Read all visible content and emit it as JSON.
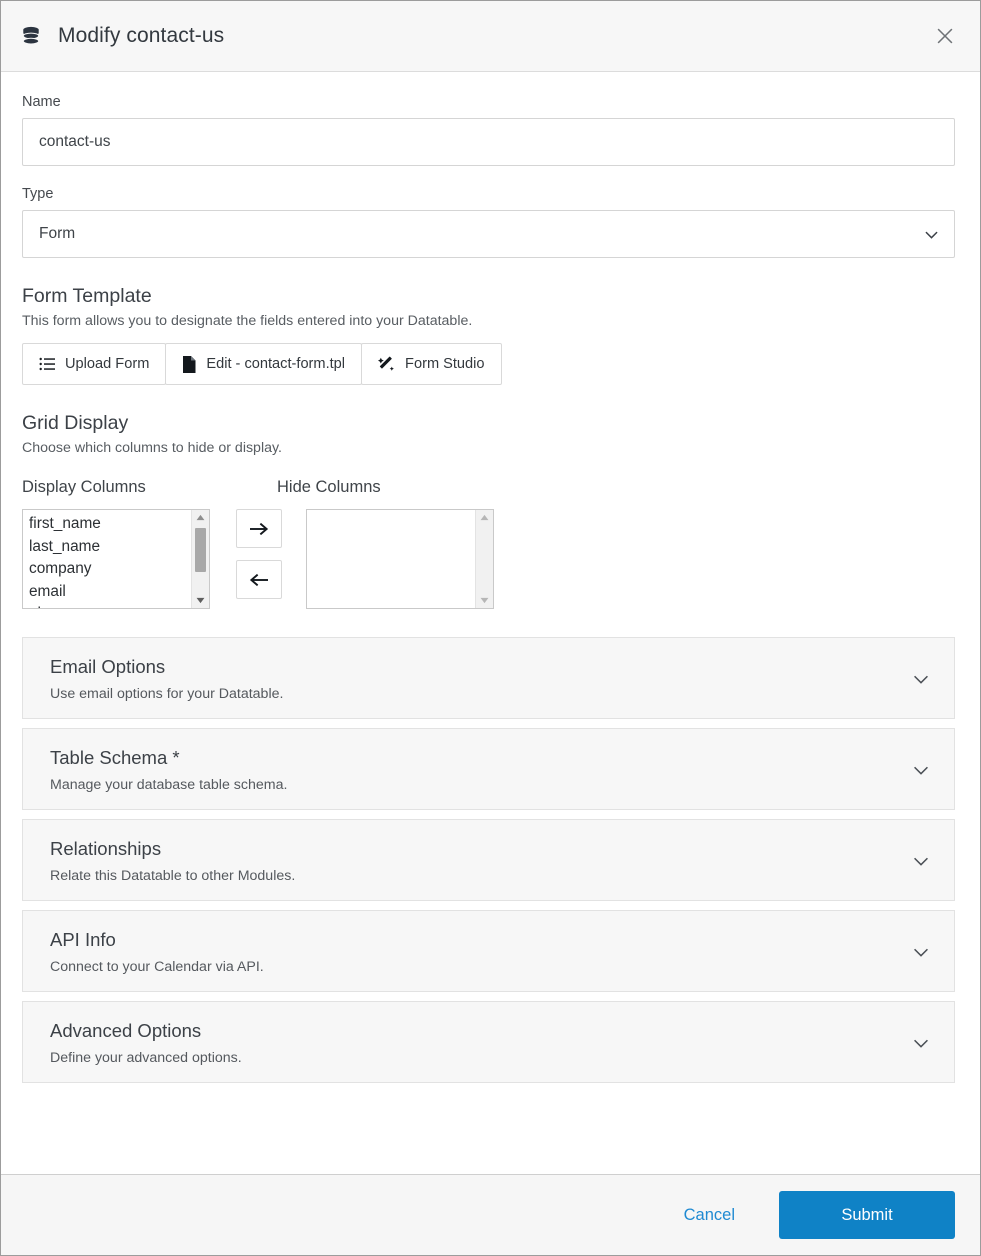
{
  "header": {
    "icon": "database-icon",
    "title": "Modify contact-us",
    "close_label": "×"
  },
  "form": {
    "name_label": "Name",
    "name_value": "contact-us",
    "name_placeholder": "",
    "type_label": "Type",
    "type_value": "Form",
    "type_options": [
      "Form"
    ]
  },
  "form_template": {
    "title": "Form Template",
    "description": "This form allows you to designate the fields entered into your Datatable.",
    "buttons": [
      {
        "label": "Upload Form",
        "icon": "list-icon"
      },
      {
        "label": "Edit - contact-form.tpl",
        "icon": "file-icon"
      },
      {
        "label": "Form Studio",
        "icon": "magic-wand-icon"
      }
    ]
  },
  "grid_display": {
    "title": "Grid Display",
    "description": "Choose which columns to hide or display.",
    "display_columns_label": "Display Columns",
    "hide_columns_label": "Hide Columns",
    "display_columns": [
      "first_name",
      "last_name",
      "company",
      "email",
      "phone"
    ],
    "hide_columns": [],
    "move_right_label": "→",
    "move_left_label": "←"
  },
  "panels": [
    {
      "title": "Email Options",
      "description": "Use email options for your Datatable."
    },
    {
      "title": "Table Schema *",
      "description": "Manage your database table schema."
    },
    {
      "title": "Relationships",
      "description": "Relate this Datatable to other Modules."
    },
    {
      "title": "API Info",
      "description": "Connect to your Calendar via API."
    },
    {
      "title": "Advanced Options",
      "description": "Define your advanced options."
    }
  ],
  "footer": {
    "cancel_label": "Cancel",
    "submit_label": "Submit"
  },
  "colors": {
    "accent_blue": "#0f82c6",
    "link_blue": "#1f8ad2",
    "panel_bg": "#f7f7f7",
    "header_bg": "#f7f7f7"
  }
}
